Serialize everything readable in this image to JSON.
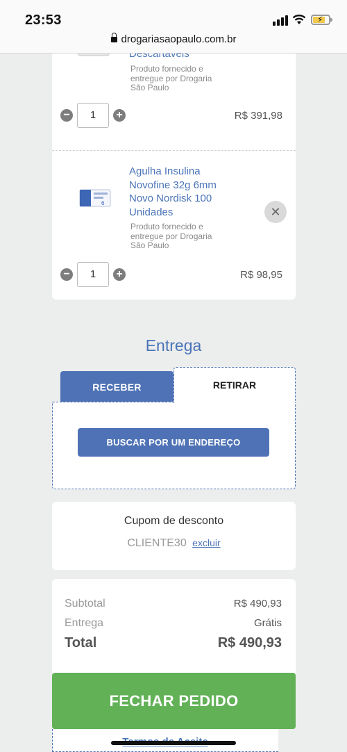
{
  "status_bar": {
    "time": "23:53"
  },
  "browser": {
    "url": "drogariasaopaulo.com.br"
  },
  "cart": {
    "items": [
      {
        "name": "Descartáveis",
        "seller": "Produto fornecido e entregue por Drogaria São Paulo",
        "quantity": "1",
        "price": "R$ 391,98"
      },
      {
        "name": "Agulha Insulina Novofine 32g 6mm Novo Nordisk 100 Unidades",
        "seller": "Produto fornecido e entregue por Drogaria São Paulo",
        "quantity": "1",
        "price": "R$ 98,95",
        "remove_icon": "x-icon"
      }
    ],
    "minus_icon": "minus-circle-icon",
    "plus_icon": "plus-circle-icon"
  },
  "entrega": {
    "title": "Entrega",
    "tabs": [
      {
        "label": "RECEBER"
      },
      {
        "label": "RETIRAR",
        "selected": true
      }
    ],
    "search_button": "BUSCAR POR UM ENDEREÇO"
  },
  "cupom": {
    "title": "Cupom de desconto",
    "code": "CLIENTE30",
    "remove_label": "excluir"
  },
  "totals": {
    "subtotal_label": "Subtotal",
    "subtotal_value": "R$ 490,93",
    "delivery_label": "Entrega",
    "delivery_value": "Grátis",
    "total_label": "Total",
    "total_value": "R$ 490,93"
  },
  "checkout_button": "FECHAR PEDIDO",
  "terms_link": "Termos de Aceite",
  "colors": {
    "link_blue": "#4a74b8",
    "button_blue": "#4e72b5",
    "checkout_green": "#62b157",
    "background": "#eceded"
  }
}
